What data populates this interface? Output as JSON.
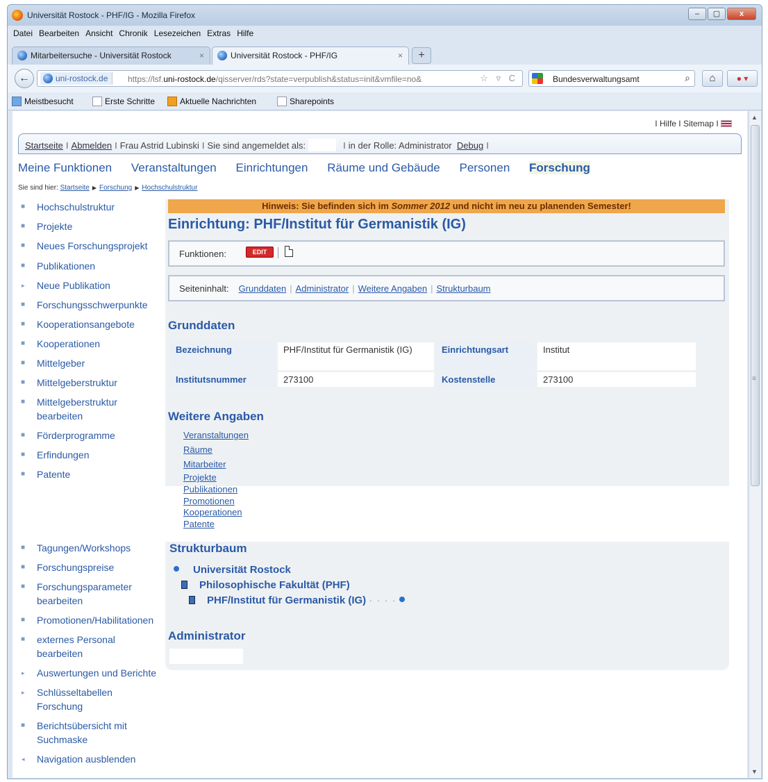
{
  "window": {
    "title": "Universität Rostock - PHF/IG - Mozilla Firefox",
    "min": "–",
    "max": "▢",
    "close": "x"
  },
  "menu": [
    "Datei",
    "Bearbeiten",
    "Ansicht",
    "Chronik",
    "Lesezeichen",
    "Extras",
    "Hilfe"
  ],
  "tabs": [
    {
      "label": "Mitarbeitersuche - Universität Rostock",
      "close": "×"
    },
    {
      "label": "Universität Rostock - PHF/IG",
      "close": "×"
    }
  ],
  "newtab": "+",
  "nav": {
    "back": "←",
    "site": "uni-rostock.de",
    "url_prefix": "https://lsf.",
    "url_domain": "uni-rostock.de",
    "url_rest": "/qisserver/rds?state=verpublish&status=init&vmfile=no&",
    "url_icons": "☆ ▿ C",
    "search": "Bundesverwaltungsamt",
    "search_icon": "⌕",
    "home": "⌂",
    "addon": "● ▾"
  },
  "bookmarks": [
    "Meistbesucht",
    "Erste Schritte",
    "Aktuelle Nachrichten",
    "Sharepoints"
  ],
  "scroll": {
    "up": "▲",
    "down": "▼",
    "grip": "≡"
  },
  "page": {
    "toplinks": "I Hilfe I Sitemap I",
    "userbar": {
      "startseite": "Startseite",
      "abmelden": "Abmelden",
      "user": "Frau Astrid Lubinski",
      "logged_in_as": "Sie sind angemeldet als:",
      "role": "in der Rolle: Administrator",
      "debug": "Debug",
      "sep": "I"
    },
    "mainnav": [
      "Meine Funktionen",
      "Veranstaltungen",
      "Einrichtungen",
      "Räume und Gebäude",
      "Personen",
      "Forschung"
    ],
    "breadcrumb": {
      "prefix": "Sie sind hier:",
      "items": [
        "Startseite",
        "Forschung",
        "Hochschulstruktur"
      ],
      "arrow": "▶"
    },
    "sidebar": [
      {
        "label": "Hochschulstruktur",
        "bullet": "■"
      },
      {
        "label": "Projekte",
        "bullet": "■"
      },
      {
        "label": "Neues Forschungsprojekt",
        "bullet": "■"
      },
      {
        "label": "Publikationen",
        "bullet": "■"
      },
      {
        "label": "Neue Publikation",
        "bullet": "▸"
      },
      {
        "label": "Forschungsschwerpunkte",
        "bullet": "■"
      },
      {
        "label": "Kooperationsangebote",
        "bullet": "■"
      },
      {
        "label": "Kooperationen",
        "bullet": "■"
      },
      {
        "label": "Mittelgeber",
        "bullet": "■"
      },
      {
        "label": "Mittelgeberstruktur",
        "bullet": "■"
      },
      {
        "label": "Mittelgeberstruktur bearbeiten",
        "bullet": "■"
      },
      {
        "label": "Förderprogramme",
        "bullet": "■"
      },
      {
        "label": "Erfindungen",
        "bullet": "■"
      },
      {
        "label": "Patente",
        "bullet": "■"
      },
      {
        "label": "Tagungen/Workshops",
        "bullet": "■"
      },
      {
        "label": "Forschungspreise",
        "bullet": "■"
      },
      {
        "label": "Forschungsparameter bearbeiten",
        "bullet": "■"
      },
      {
        "label": "Promotionen/Habilitationen",
        "bullet": "■"
      },
      {
        "label": "externes Personal bearbeiten",
        "bullet": "■"
      },
      {
        "label": "Auswertungen und Berichte",
        "bullet": "▸"
      },
      {
        "label": "Schlüsseltabellen Forschung",
        "bullet": "▸"
      },
      {
        "label": "Berichtsübersicht mit Suchmaske",
        "bullet": "■"
      },
      {
        "label": "Navigation ausblenden",
        "bullet": "◂"
      }
    ],
    "hinweis": {
      "pre": "Hinweis: Sie befinden sich im ",
      "sem": "Sommer 2012",
      "post": " und nicht im neu zu planenden Semester!"
    },
    "title": "Einrichtung: PHF/Institut für Germanistik (IG)",
    "functions": {
      "label": "Funktionen:",
      "edit": "EDIT"
    },
    "contents": {
      "label": "Seiteninhalt:",
      "links": [
        "Grunddaten",
        "Administrator",
        "Weitere Angaben",
        "Strukturbaum"
      ],
      "sep": "|"
    },
    "grunddaten": {
      "heading": "Grunddaten",
      "rows": [
        [
          "Bezeichnung",
          "PHF/Institut für Germanistik (IG)",
          "Einrichtungsart",
          "Institut"
        ],
        [
          "Institutsnummer",
          "273100",
          "Kostenstelle",
          "273100"
        ]
      ]
    },
    "weitere": {
      "heading": "Weitere Angaben",
      "links": [
        "Veranstaltungen",
        "Räume",
        "Mitarbeiter",
        "Projekte",
        "Publikationen",
        "Promotionen",
        "Kooperationen",
        "Patente"
      ]
    },
    "struktur": {
      "heading": "Strukturbaum",
      "nodes": [
        "Universität Rostock",
        "Philosophische Fakultät (PHF)",
        "PHF/Institut für Germanistik (IG)"
      ],
      "tail": "· · · ·"
    },
    "admin": {
      "heading": "Administrator"
    }
  }
}
